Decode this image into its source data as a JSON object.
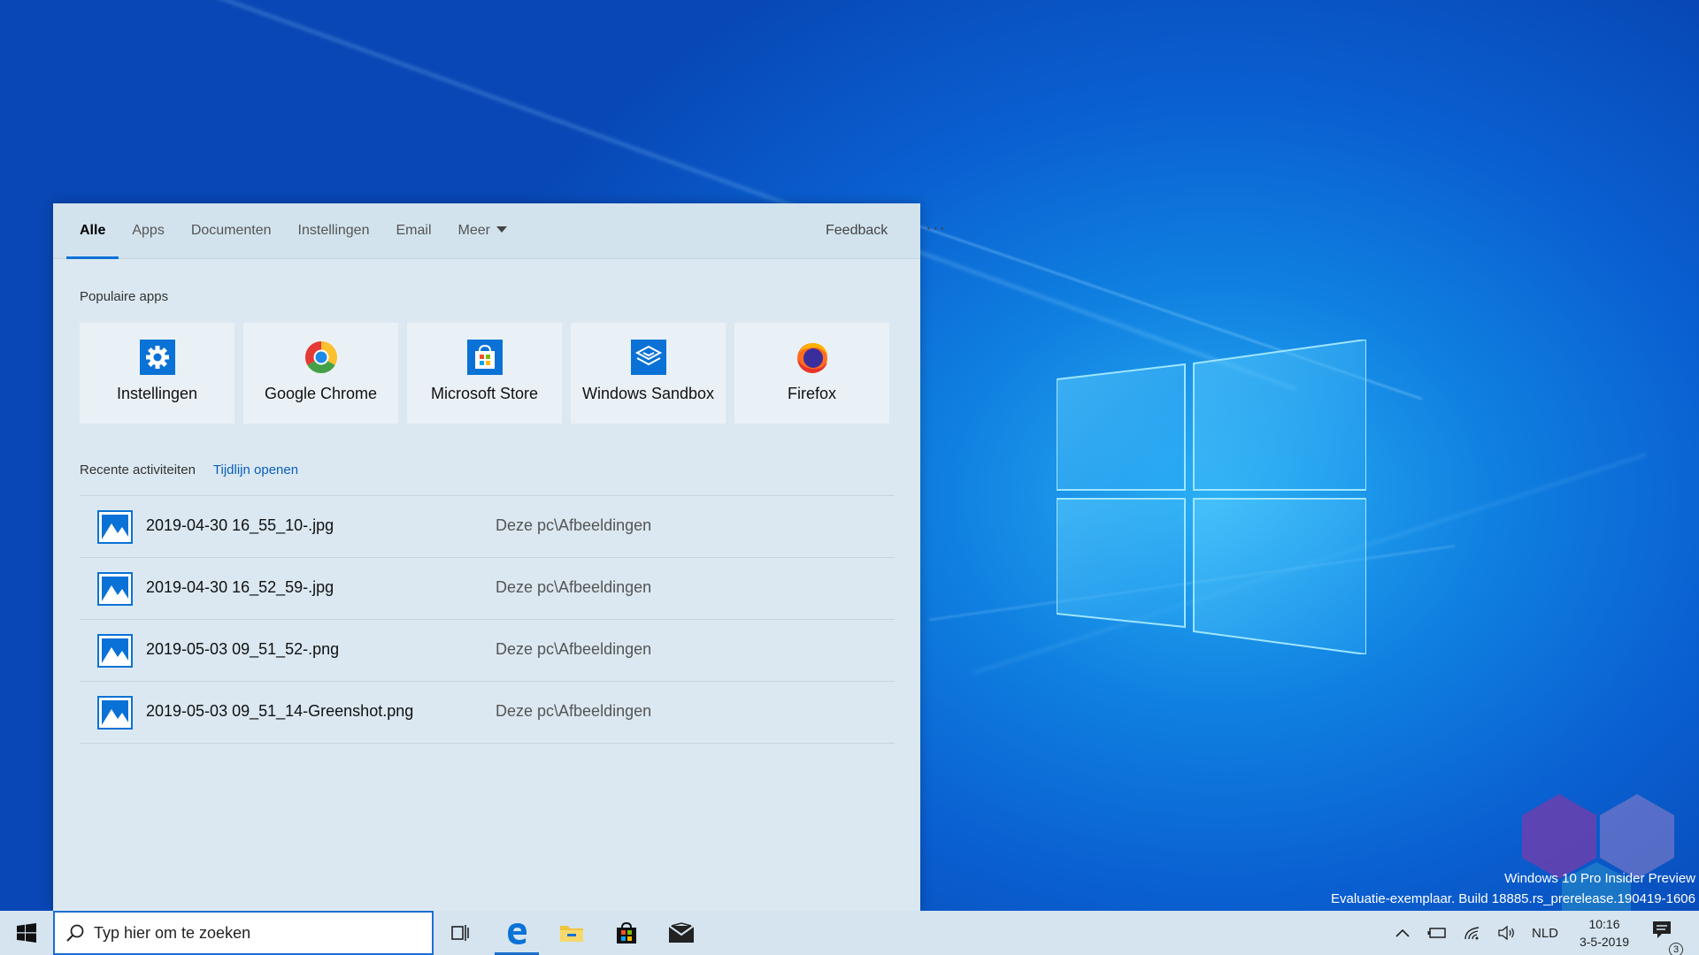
{
  "panel": {
    "tabs": [
      "Alle",
      "Apps",
      "Documenten",
      "Instellingen",
      "Email",
      "Meer"
    ],
    "feedback": "Feedback",
    "more_options": "···",
    "popular_title": "Populaire apps",
    "apps": [
      {
        "label": "Instellingen",
        "icon": "gear-icon"
      },
      {
        "label": "Google Chrome",
        "icon": "chrome-icon"
      },
      {
        "label": "Microsoft Store",
        "icon": "store-icon"
      },
      {
        "label": "Windows Sandbox",
        "icon": "sandbox-icon"
      },
      {
        "label": "Firefox",
        "icon": "firefox-icon"
      }
    ],
    "recent_title": "Recente activiteiten",
    "timeline_link": "Tijdlijn openen",
    "recent": [
      {
        "name": "2019-04-30 16_55_10-.jpg",
        "path": "Deze pc\\Afbeeldingen"
      },
      {
        "name": "2019-04-30 16_52_59-.jpg",
        "path": "Deze pc\\Afbeeldingen"
      },
      {
        "name": "2019-05-03 09_51_52-.png",
        "path": "Deze pc\\Afbeeldingen"
      },
      {
        "name": "2019-05-03 09_51_14-Greenshot.png",
        "path": "Deze pc\\Afbeeldingen"
      }
    ]
  },
  "watermark": {
    "line1": "Windows 10 Pro Insider Preview",
    "line2": "Evaluatie-exemplaar. Build 18885.rs_prerelease.190419-1606"
  },
  "taskbar": {
    "search_placeholder": "Typ hier om te zoeken",
    "language": "NLD",
    "time": "10:16",
    "date": "3-5-2019",
    "notification_count": "3"
  },
  "colors": {
    "accent": "#0a72d6",
    "panel_bg": "#dbe8f1",
    "taskbar_bg": "#d5e4ef"
  }
}
